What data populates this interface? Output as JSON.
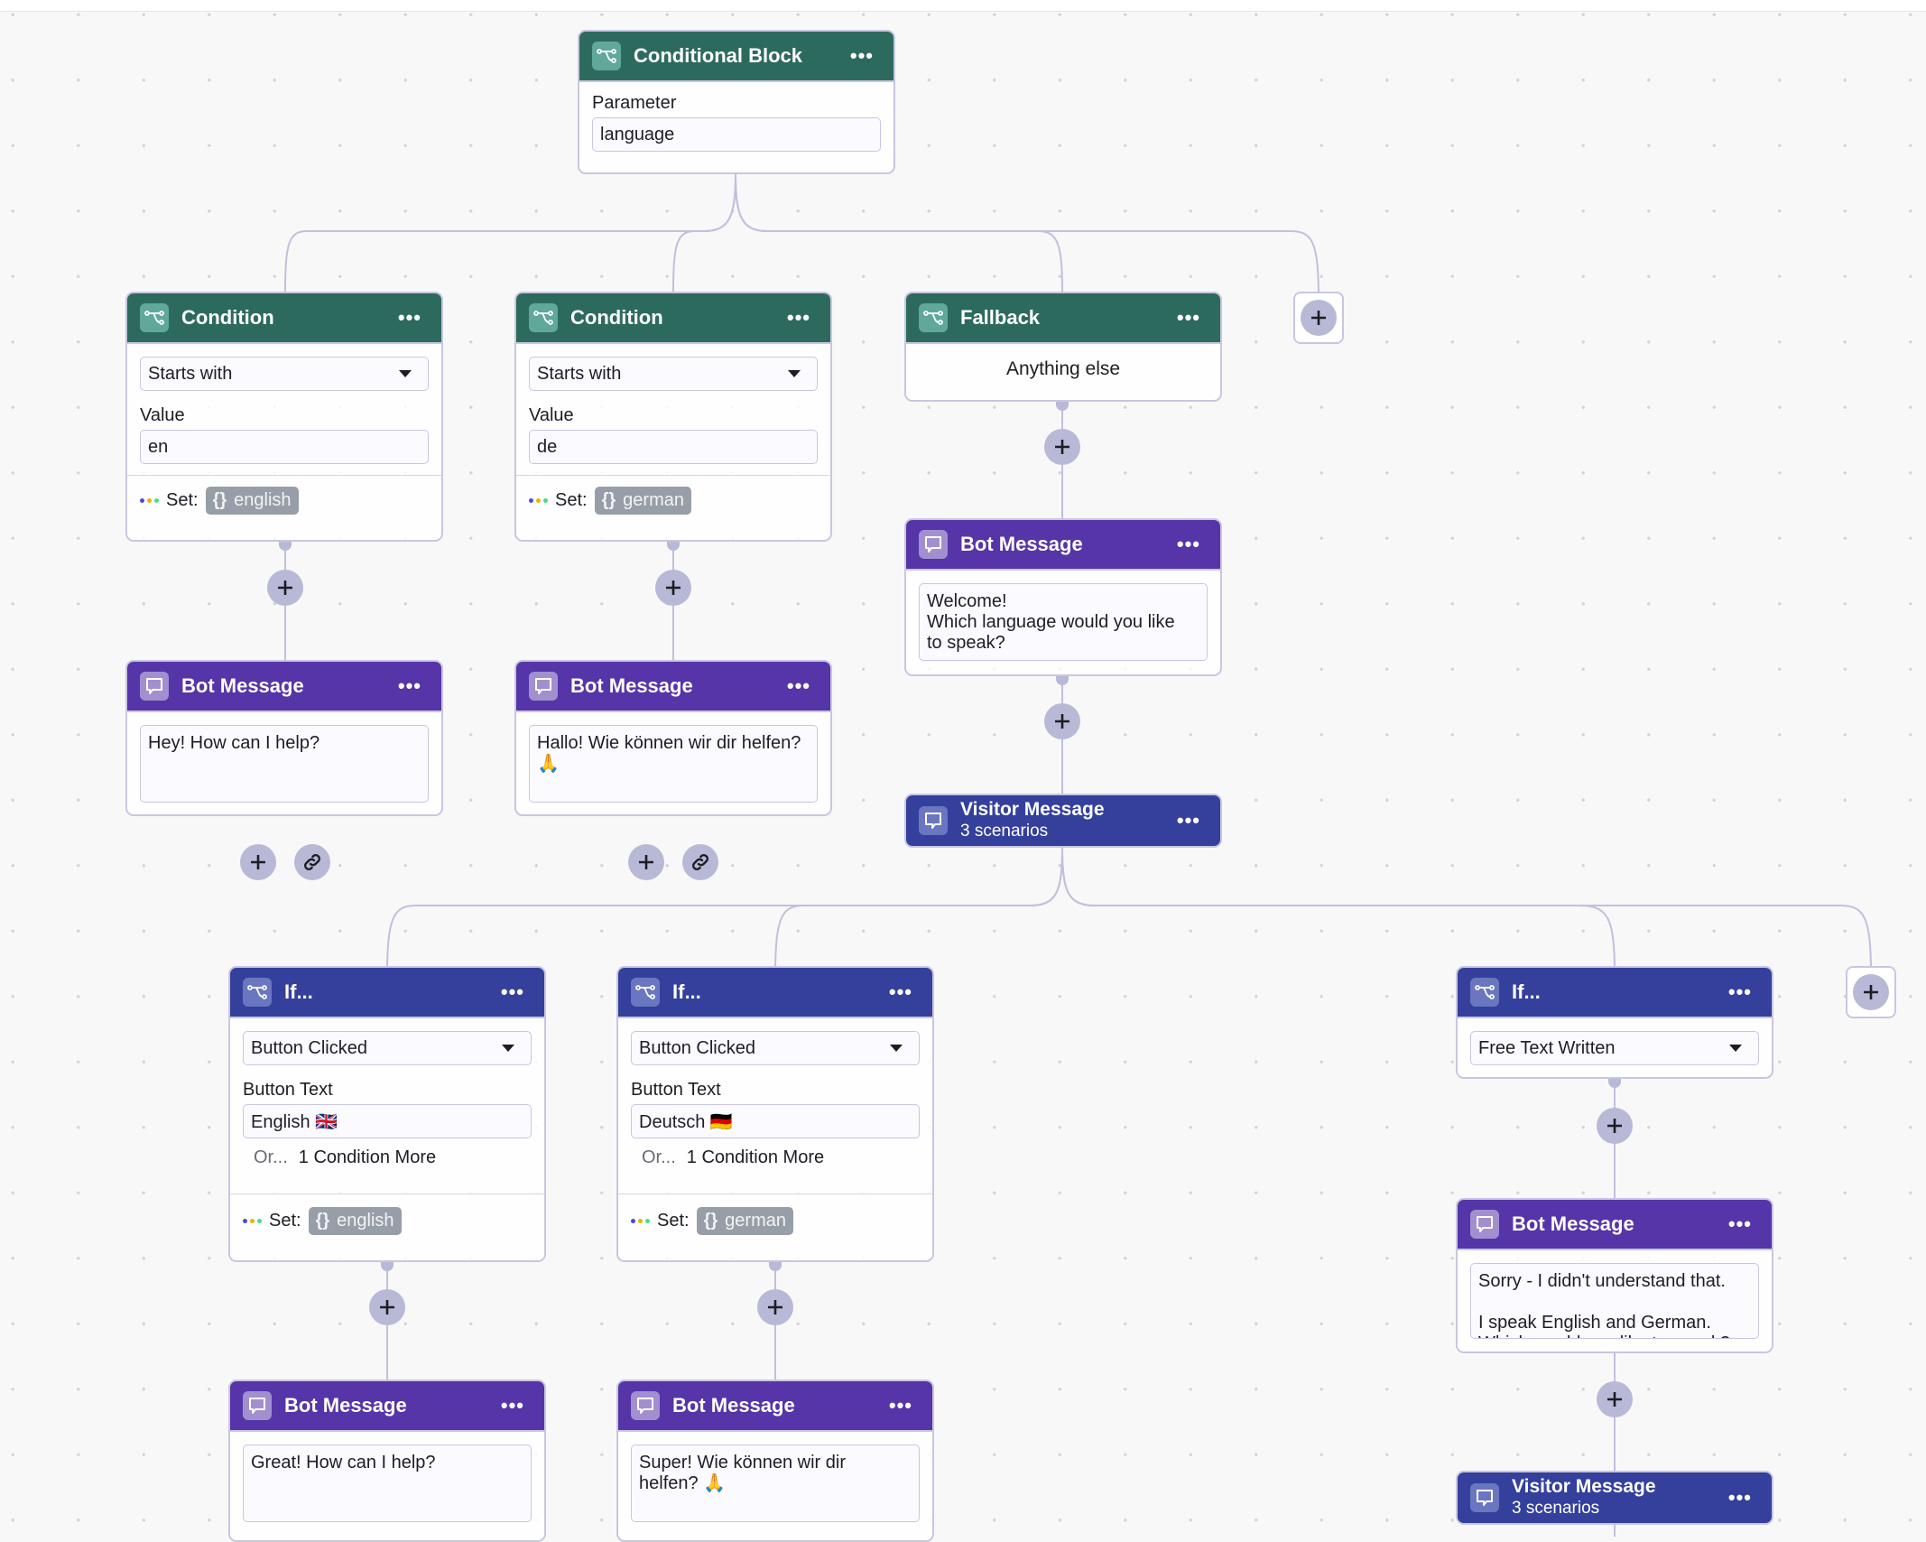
{
  "colors": {
    "condition_header": "#2d6a5e",
    "bot_message_header": "#5535a8",
    "visitor_message_header": "#34409c",
    "connector": "#c1c0dc",
    "plus_button": "#b8b9d6",
    "variable_chip": "#979ea7"
  },
  "conditional_block": {
    "title": "Conditional Block",
    "parameter_label": "Parameter",
    "parameter_value": "language"
  },
  "conditions": [
    {
      "title": "Condition",
      "operator": "Starts with",
      "value_label": "Value",
      "value": "en",
      "set_label": "Set:",
      "variable_brace": "{}",
      "variable": "english",
      "bot_message": {
        "title": "Bot Message",
        "text": "Hey! How can I help?"
      }
    },
    {
      "title": "Condition",
      "operator": "Starts with",
      "value_label": "Value",
      "value": "de",
      "set_label": "Set:",
      "variable_brace": "{}",
      "variable": "german",
      "bot_message": {
        "title": "Bot Message",
        "text": "Hallo! Wie können wir dir helfen?\n🙏"
      }
    }
  ],
  "fallback": {
    "title": "Fallback",
    "text": "Anything else",
    "bot_message": {
      "title": "Bot Message",
      "text": "Welcome!\nWhich language would you like\nto speak?"
    },
    "visitor_message": {
      "title": "Visitor Message",
      "subtitle": "3 scenarios"
    }
  },
  "scenarios": [
    {
      "title": "If...",
      "trigger": "Button Clicked",
      "field_label": "Button Text",
      "field_value": "English 🇬🇧",
      "or_label": "Or...",
      "more_label": "1 Condition More",
      "set_label": "Set:",
      "variable_brace": "{}",
      "variable": "english",
      "bot_message": {
        "title": "Bot Message",
        "text": "Great! How can I help?"
      }
    },
    {
      "title": "If...",
      "trigger": "Button Clicked",
      "field_label": "Button Text",
      "field_value": "Deutsch 🇩🇪",
      "or_label": "Or...",
      "more_label": "1 Condition More",
      "set_label": "Set:",
      "variable_brace": "{}",
      "variable": "german",
      "bot_message": {
        "title": "Bot Message",
        "text": "Super! Wie können wir dir\nhelfen? 🙏"
      }
    },
    {
      "title": "If...",
      "trigger": "Free Text Written",
      "bot_message": {
        "title": "Bot Message",
        "text": "Sorry - I didn't understand that.\n\nI speak English and German.\nWhich would you like to speak?"
      },
      "visitor_message": {
        "title": "Visitor Message",
        "subtitle": "3 scenarios"
      }
    }
  ],
  "icons": {
    "condition": "branch-icon",
    "message": "chat-bubble-icon",
    "menu": "more-horizontal-icon",
    "add": "plus-icon",
    "link": "link-icon",
    "dropdown": "caret-down-icon"
  }
}
